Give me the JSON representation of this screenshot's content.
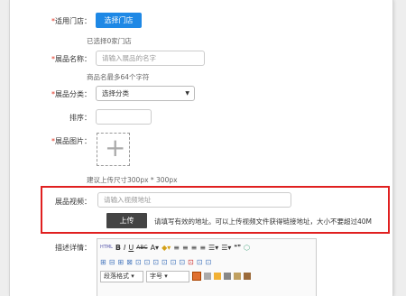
{
  "form": {
    "store": {
      "label": "适用门店：",
      "button": "选择门店",
      "hint": "已选择0家门店"
    },
    "name": {
      "label": "展品名称：",
      "placeholder": "请输入展品的名字",
      "hint": "商品名最多64个字符"
    },
    "category": {
      "label": "展品分类：",
      "selected": "选择分类"
    },
    "sort": {
      "label": "排序："
    },
    "image": {
      "label": "展品图片：",
      "hint": "建议上传尺寸300px * 300px"
    },
    "video": {
      "label": "展品视频：",
      "placeholder": "请输入视频地址",
      "upload_button": "上传",
      "hint": "请填写有效的地址。可以上传视频文件获得链接地址，大小不要超过40M"
    },
    "detail": {
      "label": "描述详情："
    }
  },
  "editor": {
    "row1": [
      "HTML",
      "B",
      "I",
      "U",
      "ABC",
      "A",
      "◆",
      "≡",
      "≡",
      "≡",
      "≡",
      "☰",
      "☰",
      "❝❞",
      "⬡"
    ],
    "row2": [
      "⊞",
      "⊟",
      "⊞",
      "⊠",
      "⊡",
      "⊡",
      "⊡",
      "⊡",
      "⊡",
      "⊡",
      "⊡",
      "⊡",
      "⊡"
    ],
    "paragraph_select": "段落格式",
    "size_select": "字号"
  },
  "colors": {
    "accent": "#1e88e5",
    "required": "#e0301e",
    "highlight": "#e02020",
    "dark_button": "#444444"
  }
}
